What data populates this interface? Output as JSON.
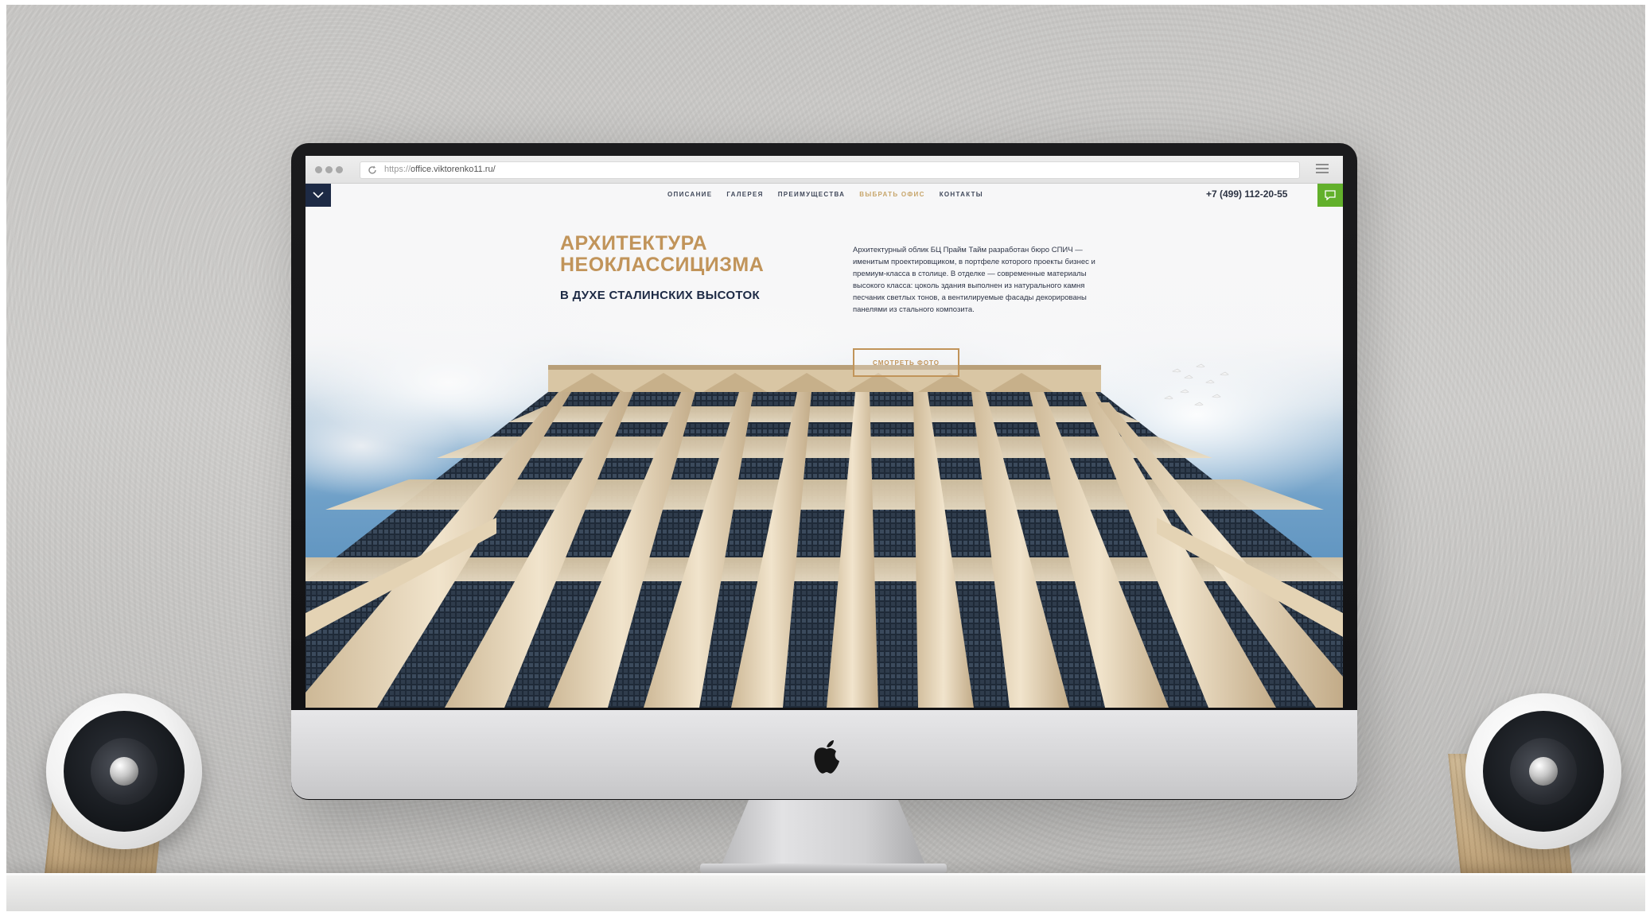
{
  "browser": {
    "url_protocol": "https://",
    "url_host": "office.viktorenko11.ru/"
  },
  "nav": {
    "items": [
      {
        "label": "ОПИСАНИЕ",
        "active": false
      },
      {
        "label": "ГАЛЕРЕЯ",
        "active": false
      },
      {
        "label": "ПРЕИМУЩЕСТВА",
        "active": false
      },
      {
        "label": "ВЫБРАТЬ ОФИС",
        "active": true
      },
      {
        "label": "КОНТАКТЫ",
        "active": false
      }
    ],
    "phone": "+7 (499) 112-20-55"
  },
  "hero": {
    "title_line1": "АРХИТЕКТУРА",
    "title_line2": "НЕОКЛАССИЦИЗМА",
    "subtitle": "В ДУХЕ СТАЛИНСКИХ ВЫСОТОК",
    "description": "Архитектурный облик БЦ Прайм Тайм разработан бюро СПИЧ — именитым проектировщиком, в портфеле которого проекты бизнес и премиум-класса в столице. В отделке — современные материалы высокого класса: цоколь здания выполнен из натурального камня песчаник светлых тонов, а вентилируемые фасады декорированы панелями из стального композита.",
    "button_label": "СМОТРЕТЬ ФОТО"
  },
  "colors": {
    "accent_gold": "#c1945a",
    "nav_active": "#c7a56a",
    "navy": "#1d2a45",
    "chat_green": "#62b02b"
  },
  "icons": {
    "nav_toggle": "chevron-down-icon",
    "chat": "chat-bubble-icon",
    "reload": "reload-icon",
    "menu": "hamburger-menu-icon",
    "brand": "apple-logo"
  }
}
